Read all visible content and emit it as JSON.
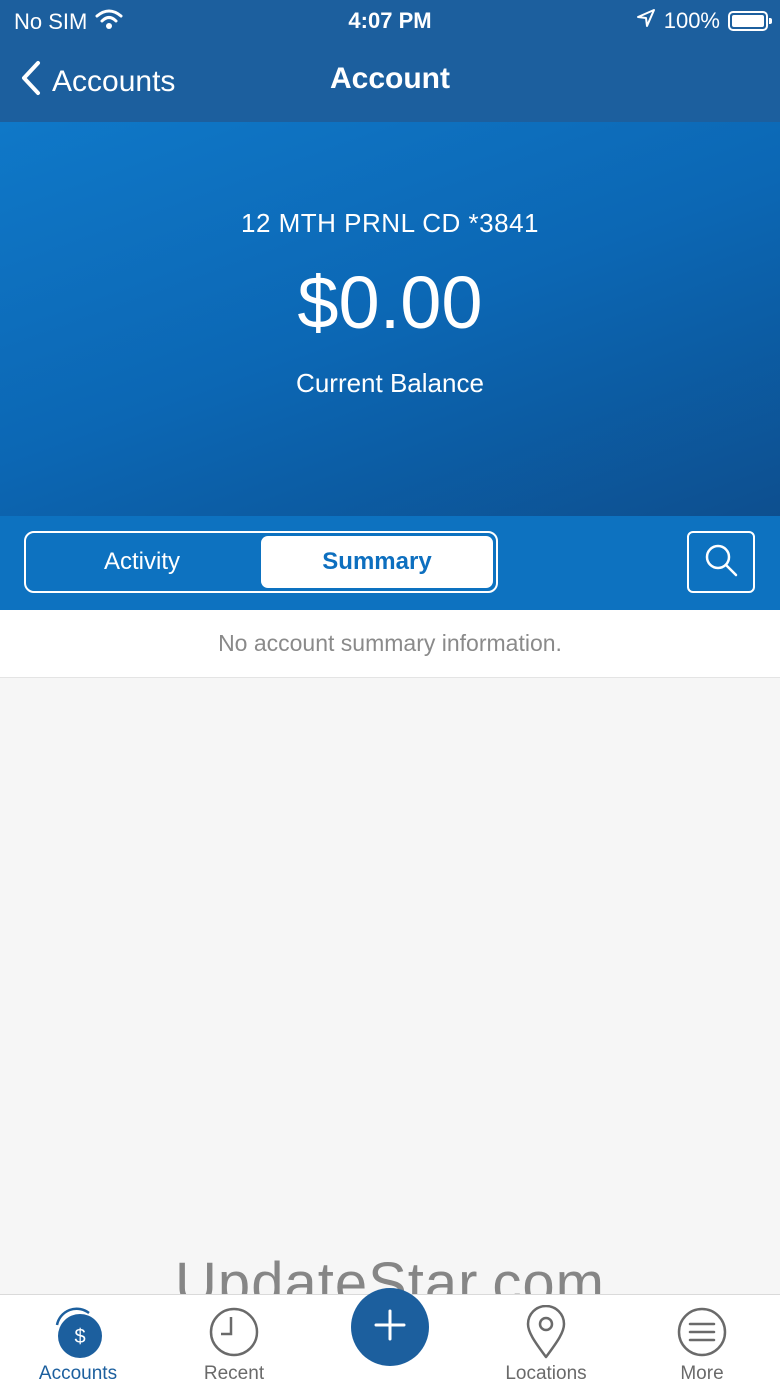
{
  "status_bar": {
    "carrier": "No SIM",
    "time": "4:07 PM",
    "battery": "100%"
  },
  "nav": {
    "back_label": "Accounts",
    "title": "Account"
  },
  "account": {
    "name": "12 MTH PRNL CD *3841",
    "balance": "$0.00",
    "balance_label": "Current Balance"
  },
  "tabs": {
    "activity": "Activity",
    "summary": "Summary",
    "selected": "summary"
  },
  "empty_message": "No account summary information.",
  "watermark": "UpdateStar.com",
  "tab_bar": {
    "items": [
      {
        "label": "Accounts",
        "icon": "accounts-dollar-icon",
        "selected": true
      },
      {
        "label": "Recent",
        "icon": "clock-icon",
        "selected": false
      },
      {
        "label": "",
        "icon": "plus-icon",
        "selected": false
      },
      {
        "label": "Locations",
        "icon": "location-pin-icon",
        "selected": false
      },
      {
        "label": "More",
        "icon": "menu-icon",
        "selected": false
      }
    ],
    "accounts_badge_symbol": "$"
  },
  "colors": {
    "brand": "#1c5f9e",
    "hero": "#0f78c8",
    "tab_strip": "#0d72c0"
  }
}
